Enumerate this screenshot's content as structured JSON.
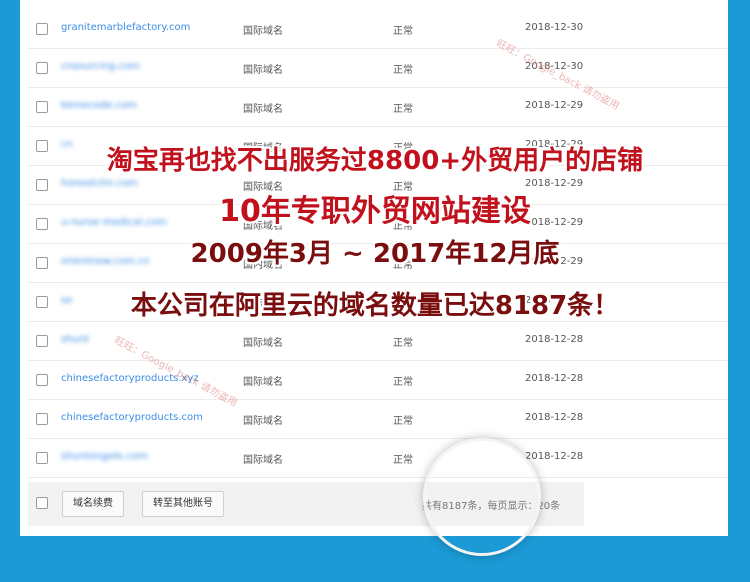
{
  "table": {
    "rows": [
      {
        "domain": "granitemarblefactory.com",
        "type": "国际域名",
        "status": "正常",
        "date": "2018-12-30"
      },
      {
        "domain": "cnsourcing.com",
        "type": "国际域名",
        "status": "正常",
        "date": "2018-12-30"
      },
      {
        "domain": "kemecode.com",
        "type": "国际域名",
        "status": "正常",
        "date": "2018-12-29"
      },
      {
        "domain": "cn",
        "type": "国际域名",
        "status": "正常",
        "date": "2018-12-29"
      },
      {
        "domain": "honestchn.com",
        "type": "国际域名",
        "status": "正常",
        "date": "2018-12-29"
      },
      {
        "domain": "u-nurse-medical.com",
        "type": "国际域名",
        "status": "正常",
        "date": "2018-12-29"
      },
      {
        "domain": "orientnew.com.cn",
        "type": "国内域名",
        "status": "正常",
        "date": "2018-12-29"
      },
      {
        "domain": "se",
        "type": "国际域名",
        "status": "正常",
        "date": "2018-12-29"
      },
      {
        "domain": "shunt",
        "type": "国际域名",
        "status": "正常",
        "date": "2018-12-28"
      },
      {
        "domain": "chinesefactoryproducts.xyz",
        "type": "国际域名",
        "status": "正常",
        "date": "2018-12-28"
      },
      {
        "domain": "chinesefactoryproducts.com",
        "type": "国际域名",
        "status": "正常",
        "date": "2018-12-28"
      },
      {
        "domain": "shuntongele.com",
        "type": "国际域名",
        "status": "正常",
        "date": "2018-12-28"
      }
    ]
  },
  "footer": {
    "renew_button": "域名续费",
    "transfer_button": "转至其他账号",
    "page_info": "共有8187条，每页显示：20条"
  },
  "watermark": {
    "text1": "旺旺：Google_back  请勿盗用",
    "text2": "旺旺：Google_back  请勿盗用"
  },
  "overlay": {
    "line1": "淘宝再也找不出服务过8800+外贸用户的店铺",
    "line2": "10年专职外贸网站建设",
    "line3": "2009年3月 ~ 2017年12月底",
    "line4": "本公司在阿里云的域名数量已达8187条！"
  }
}
